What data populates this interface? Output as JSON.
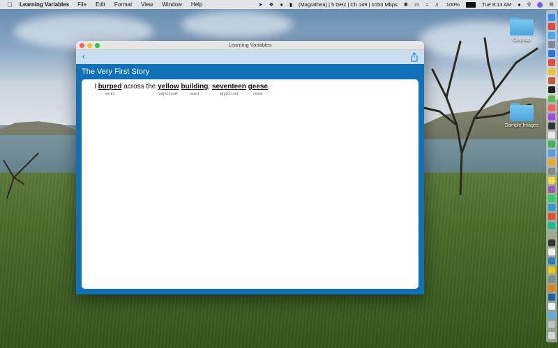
{
  "menubar": {
    "app_name": "Learning Variables",
    "menus": [
      "File",
      "Edit",
      "Format",
      "View",
      "Window",
      "Help"
    ],
    "wifi_status": "(Magrathea) | 5 GHz | Ch 149 | 1053 Mbps",
    "battery": "100%",
    "clock": "Tue 9:13 AM"
  },
  "desktop": {
    "items": [
      "Cleanup",
      "Sample Images"
    ]
  },
  "window": {
    "title": "Learning Variables",
    "story_title": "The Very First Story",
    "sentence": {
      "lead": "I",
      "words": [
        {
          "text": "burped",
          "tag": "verb1"
        },
        {
          "text": "yellow",
          "tag": "adjective1"
        },
        {
          "text": "building",
          "tag": "noun1"
        },
        {
          "text": "seventeen",
          "tag": "adjective2"
        },
        {
          "text": "geese",
          "tag": "noun2"
        }
      ],
      "between_1": "across the",
      "comma": ",",
      "period": "."
    }
  },
  "colors": {
    "window_blue": "#1070b8",
    "toolbar": "#c9dff0",
    "accent": "#1e7ad3"
  }
}
